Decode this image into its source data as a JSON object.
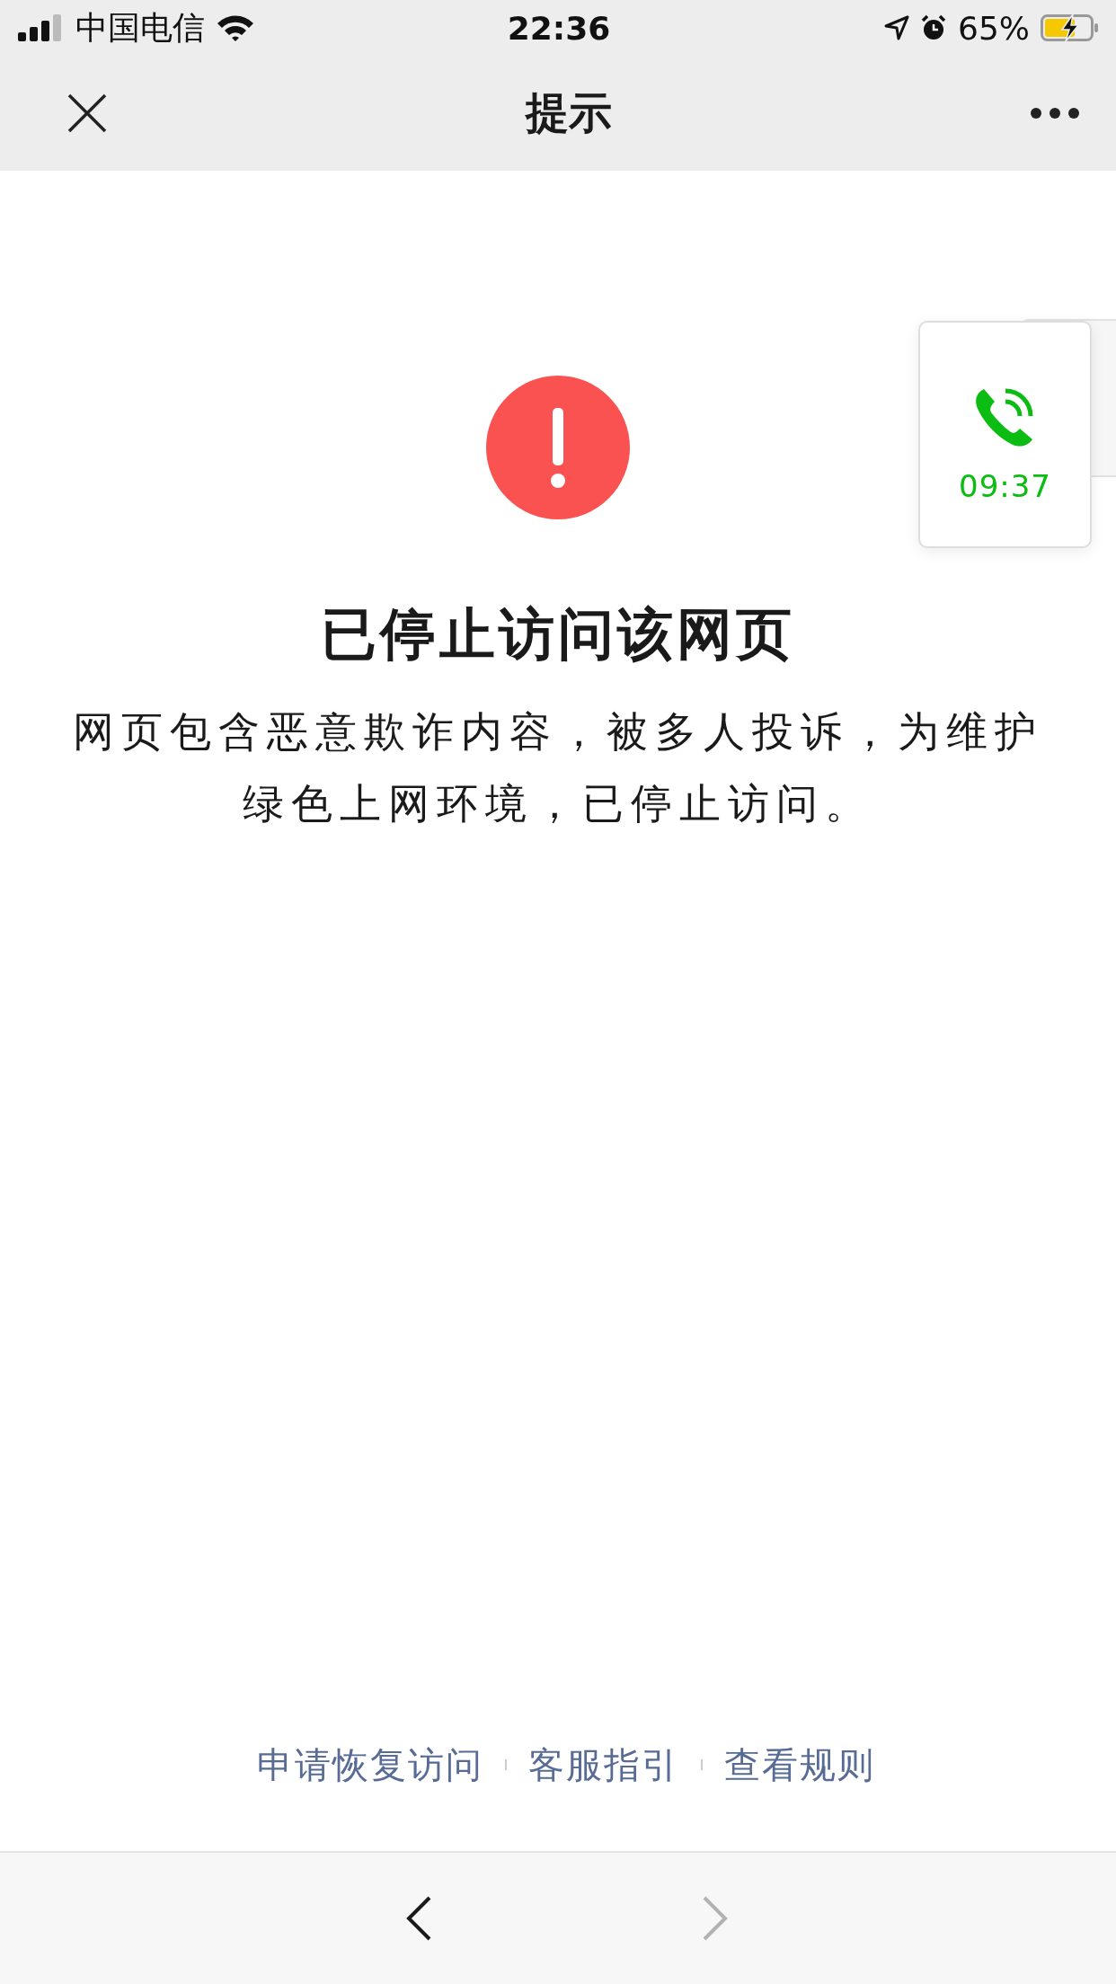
{
  "status_bar": {
    "carrier": "中国电信",
    "time": "22:36",
    "battery": "65%"
  },
  "nav_bar": {
    "title": "提示"
  },
  "call_widget": {
    "duration": "09:37"
  },
  "notice": {
    "title": "已停止访问该网页",
    "message": "网页包含恶意欺诈内容，被多人投诉，为维护绿色上网环境，已停止访问。"
  },
  "links": [
    "申请恢复访问",
    "客服指引",
    "查看规则"
  ],
  "toolbar": {
    "back": {
      "disabled": false
    },
    "forward": {
      "disabled": true
    }
  }
}
